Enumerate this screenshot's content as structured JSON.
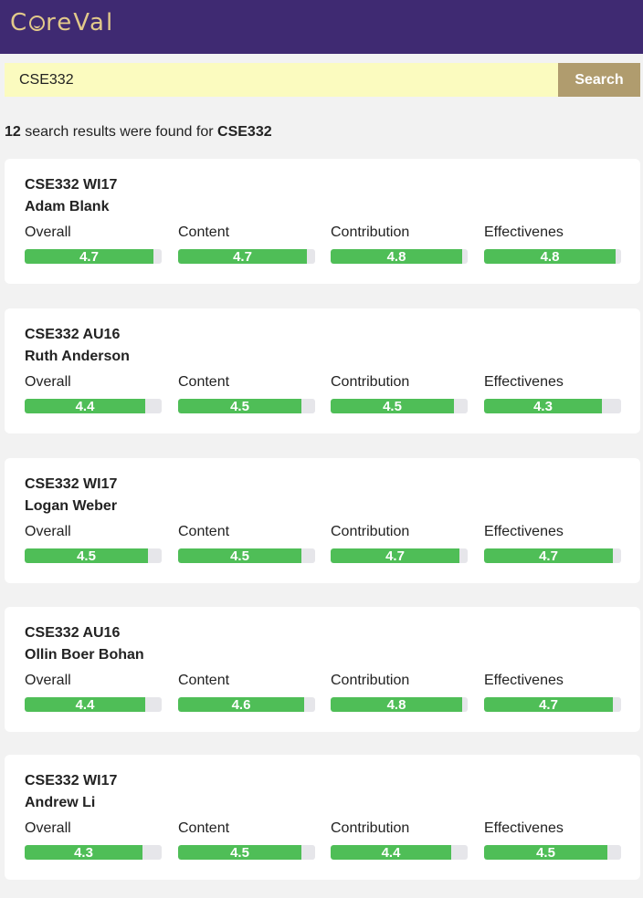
{
  "app": {
    "brand_letter_c": "C",
    "brand_rest": "reVal",
    "colors": {
      "header": "#3f2a72",
      "brand": "#e2c98a",
      "search_field": "#fbfbbf",
      "search_button": "#b09c6e",
      "bar_fill": "#4fbe57",
      "bar_track": "#e6e6ea"
    }
  },
  "search": {
    "value": "CSE332",
    "button_label": "Search"
  },
  "summary": {
    "count": "12",
    "text": " search results were found for ",
    "query": "CSE332"
  },
  "metric_labels": [
    "Overall",
    "Content",
    "Contribution",
    "Effectivenes"
  ],
  "rating_max": 5,
  "results": [
    {
      "course": "CSE332 WI17",
      "instructor": "Adam Blank",
      "ratings": [
        "4.7",
        "4.7",
        "4.8",
        "4.8"
      ]
    },
    {
      "course": "CSE332 AU16",
      "instructor": "Ruth Anderson",
      "ratings": [
        "4.4",
        "4.5",
        "4.5",
        "4.3"
      ]
    },
    {
      "course": "CSE332 WI17",
      "instructor": "Logan Weber",
      "ratings": [
        "4.5",
        "4.5",
        "4.7",
        "4.7"
      ]
    },
    {
      "course": "CSE332 AU16",
      "instructor": "Ollin Boer Bohan",
      "ratings": [
        "4.4",
        "4.6",
        "4.8",
        "4.7"
      ]
    },
    {
      "course": "CSE332 WI17",
      "instructor": "Andrew Li",
      "ratings": [
        "4.3",
        "4.5",
        "4.4",
        "4.5"
      ]
    }
  ]
}
